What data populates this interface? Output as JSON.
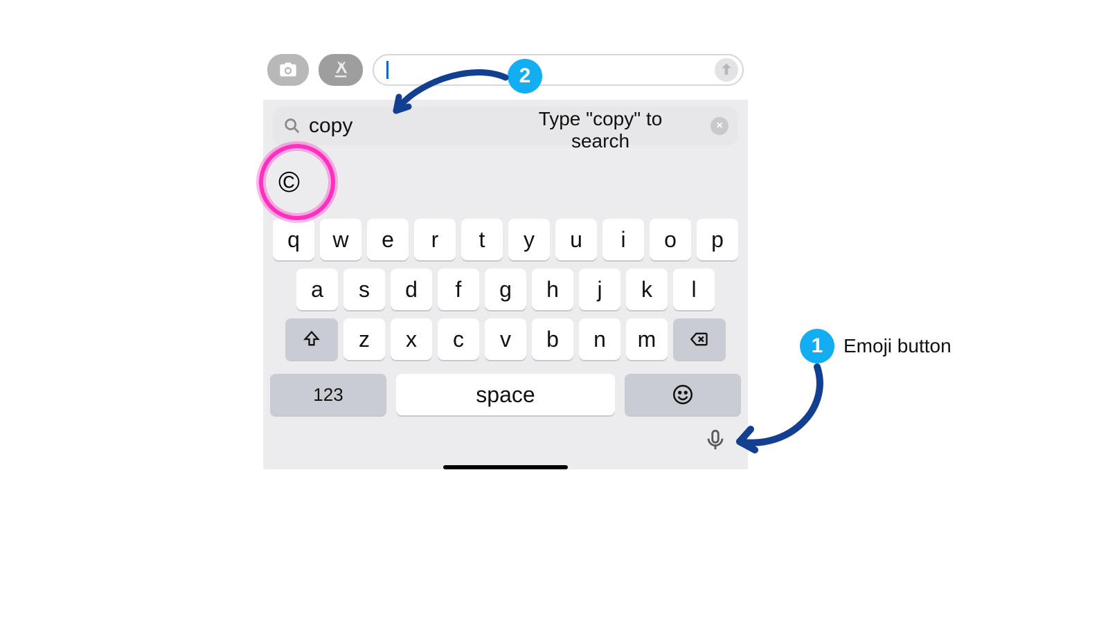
{
  "toolbar": {
    "camera": "camera-icon",
    "apps": "app-store-icon",
    "send": "arrow-up-icon",
    "message_value": ""
  },
  "search": {
    "value": "copy",
    "clear": "×",
    "icon": "magnifying-glass-icon"
  },
  "result": {
    "glyph": "©"
  },
  "rows": {
    "r1": [
      "q",
      "w",
      "e",
      "r",
      "t",
      "y",
      "u",
      "i",
      "o",
      "p"
    ],
    "r2": [
      "a",
      "s",
      "d",
      "f",
      "g",
      "h",
      "j",
      "k",
      "l"
    ],
    "r3": [
      "z",
      "x",
      "c",
      "v",
      "b",
      "n",
      "m"
    ]
  },
  "fn": {
    "shift": "shift-icon",
    "backspace": "backspace-icon",
    "numeric": "123",
    "space": "space",
    "emoji": "emoji-icon",
    "mic": "mic-icon"
  },
  "annotations": {
    "step1_badge": "1",
    "step1_text": "Emoji button",
    "step2_badge": "2",
    "step2_text_l1": "Type \"copy\" to",
    "step2_text_l2": "search"
  },
  "colors": {
    "badge": "#13aef2",
    "arrow": "#123f8f",
    "ring": "#ff2fbf"
  }
}
